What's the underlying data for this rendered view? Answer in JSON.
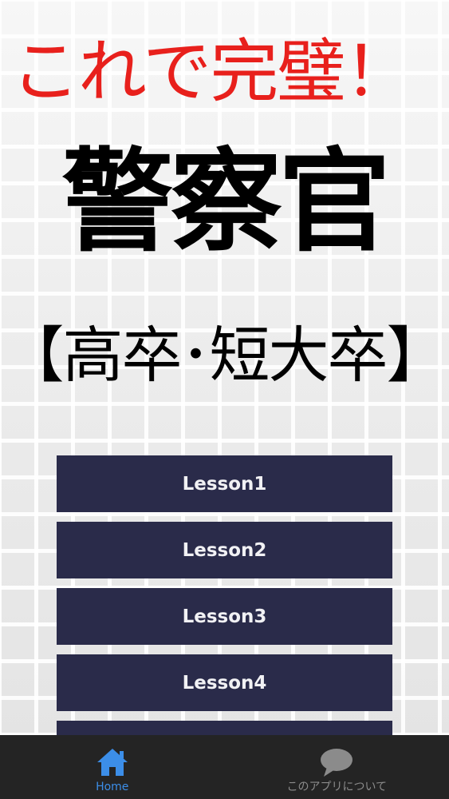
{
  "header": {
    "headline": "これで完璧！",
    "title": "警察官",
    "subtitle": "【高卒･短大卒】"
  },
  "lessons": [
    {
      "label": "Lesson1"
    },
    {
      "label": "Lesson2"
    },
    {
      "label": "Lesson3"
    },
    {
      "label": "Lesson4"
    }
  ],
  "bottom_nav": {
    "items": [
      {
        "label": "Home",
        "icon": "home-icon",
        "active": true
      },
      {
        "label": "このアプリについて",
        "icon": "speech-bubble-icon",
        "active": false
      }
    ]
  },
  "colors": {
    "headline": "#e8201c",
    "lesson_button_bg": "#2a2b4a",
    "nav_bg": "#242424",
    "nav_active": "#3c8ee8",
    "nav_inactive": "#8b8b8b"
  }
}
